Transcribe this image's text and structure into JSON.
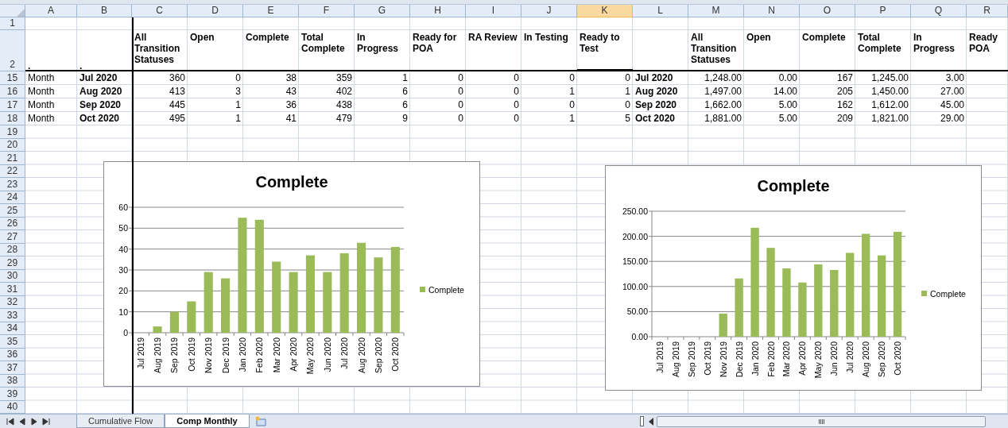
{
  "column_headers": [
    {
      "label": "A",
      "selected": false
    },
    {
      "label": "B",
      "selected": false
    },
    {
      "label": "C",
      "selected": false
    },
    {
      "label": "D",
      "selected": false
    },
    {
      "label": "E",
      "selected": false
    },
    {
      "label": "F",
      "selected": false
    },
    {
      "label": "G",
      "selected": false
    },
    {
      "label": "H",
      "selected": false
    },
    {
      "label": "I",
      "selected": false
    },
    {
      "label": "J",
      "selected": false
    },
    {
      "label": "K",
      "selected": true
    },
    {
      "label": "L",
      "selected": false
    },
    {
      "label": "M",
      "selected": false
    },
    {
      "label": "N",
      "selected": false
    },
    {
      "label": "O",
      "selected": false
    },
    {
      "label": "P",
      "selected": false
    },
    {
      "label": "Q",
      "selected": false
    },
    {
      "label": "R",
      "selected": false
    }
  ],
  "rows": [
    {
      "number": "1",
      "kind": "blank",
      "cells": []
    },
    {
      "number": "2",
      "kind": "header",
      "cells": [
        ".",
        ".",
        "All Transition Statuses",
        "Open",
        "Complete",
        "Total Complete",
        "In Progress",
        "Ready for POA",
        "RA Review",
        "In Testing",
        "Ready to Test",
        null,
        "All Transition Statuses",
        "Open",
        "Complete",
        "Total Complete",
        "In Progress",
        "Ready POA"
      ]
    },
    {
      "number": "15",
      "kind": "data",
      "cells": [
        "Month",
        "Jul 2020",
        "360",
        "0",
        "38",
        "359",
        "1",
        "0",
        "0",
        "0",
        "0",
        "Jul 2020",
        "1,248.00",
        "0.00",
        "167",
        "1,245.00",
        "3.00",
        null
      ]
    },
    {
      "number": "16",
      "kind": "data",
      "cells": [
        "Month",
        "Aug 2020",
        "413",
        "3",
        "43",
        "402",
        "6",
        "0",
        "0",
        "1",
        "1",
        "Aug 2020",
        "1,497.00",
        "14.00",
        "205",
        "1,450.00",
        "27.00",
        null
      ]
    },
    {
      "number": "17",
      "kind": "data",
      "cells": [
        "Month",
        "Sep 2020",
        "445",
        "1",
        "36",
        "438",
        "6",
        "0",
        "0",
        "0",
        "0",
        "Sep 2020",
        "1,662.00",
        "5.00",
        "162",
        "1,612.00",
        "45.00",
        null
      ]
    },
    {
      "number": "18",
      "kind": "data",
      "cells": [
        "Month",
        "Oct 2020",
        "495",
        "1",
        "41",
        "479",
        "9",
        "0",
        "0",
        "1",
        "5",
        "Oct 2020",
        "1,881.00",
        "5.00",
        "209",
        "1,821.00",
        "29.00",
        null
      ]
    },
    {
      "number": "19",
      "kind": "blank",
      "cells": []
    },
    {
      "number": "20",
      "kind": "blank",
      "cells": []
    },
    {
      "number": "21",
      "kind": "blank",
      "cells": []
    },
    {
      "number": "22",
      "kind": "blank",
      "cells": []
    },
    {
      "number": "23",
      "kind": "blank",
      "cells": []
    },
    {
      "number": "24",
      "kind": "blank",
      "cells": []
    },
    {
      "number": "25",
      "kind": "blank",
      "cells": []
    },
    {
      "number": "26",
      "kind": "blank",
      "cells": []
    },
    {
      "number": "27",
      "kind": "blank",
      "cells": []
    },
    {
      "number": "28",
      "kind": "blank",
      "cells": []
    },
    {
      "number": "29",
      "kind": "blank",
      "cells": []
    },
    {
      "number": "30",
      "kind": "blank",
      "cells": []
    },
    {
      "number": "31",
      "kind": "blank",
      "cells": []
    },
    {
      "number": "32",
      "kind": "blank",
      "cells": []
    },
    {
      "number": "33",
      "kind": "blank",
      "cells": []
    },
    {
      "number": "34",
      "kind": "blank",
      "cells": []
    },
    {
      "number": "35",
      "kind": "blank",
      "cells": []
    },
    {
      "number": "36",
      "kind": "blank",
      "cells": []
    },
    {
      "number": "37",
      "kind": "blank",
      "cells": []
    },
    {
      "number": "38",
      "kind": "blank",
      "cells": []
    },
    {
      "number": "39",
      "kind": "blank",
      "cells": []
    },
    {
      "number": "40",
      "kind": "blank",
      "cells": []
    }
  ],
  "charts": [
    {
      "chart_data": {
        "type": "bar",
        "title": "Complete",
        "categories": [
          "Jul 2019",
          "Aug 2019",
          "Sep 2019",
          "Oct 2019",
          "Nov 2019",
          "Dec 2019",
          "Jan 2020",
          "Feb 2020",
          "Mar 2020",
          "Apr 2020",
          "May 2020",
          "Jun 2020",
          "Jul 2020",
          "Aug 2020",
          "Sep 2020",
          "Oct 2020"
        ],
        "series": [
          {
            "name": "Complete",
            "color": "#9bbb59",
            "values": [
              0,
              3,
              10,
              15,
              29,
              26,
              55,
              54,
              34,
              29,
              37,
              29,
              38,
              43,
              36,
              41
            ]
          }
        ],
        "grid": true,
        "ylim": [
          0,
          60
        ],
        "yticks": [
          0,
          10,
          20,
          30,
          40,
          50,
          60
        ]
      }
    },
    {
      "chart_data": {
        "type": "bar",
        "title": "Complete",
        "categories": [
          "Jul 2019",
          "Aug 2019",
          "Sep 2019",
          "Oct 2019",
          "Nov 2019",
          "Dec 2019",
          "Jan 2020",
          "Feb 2020",
          "Mar 2020",
          "Apr 2020",
          "May 2020",
          "Jun 2020",
          "Jul 2020",
          "Aug 2020",
          "Sep 2020",
          "Oct 2020"
        ],
        "series": [
          {
            "name": "Complete",
            "color": "#9bbb59",
            "values": [
              0,
              0,
              0,
              0,
              46,
              116,
              217,
              177,
              136,
              108,
              144,
              133,
              167,
              205,
              162,
              209
            ]
          }
        ],
        "grid": true,
        "ylim": [
          0,
          250
        ],
        "yticks": [
          {
            "value": 0,
            "label": "0.00"
          },
          {
            "value": 50,
            "label": "50.00"
          },
          {
            "value": 100,
            "label": "100.00"
          },
          {
            "value": 150,
            "label": "150.00"
          },
          {
            "value": 200,
            "label": "200.00"
          },
          {
            "value": 250,
            "label": "250.00"
          }
        ]
      }
    }
  ],
  "sheet_tabs": [
    {
      "label": "Cumulative Flow",
      "selected": false
    },
    {
      "label": "Comp Monthly",
      "selected": true
    }
  ]
}
